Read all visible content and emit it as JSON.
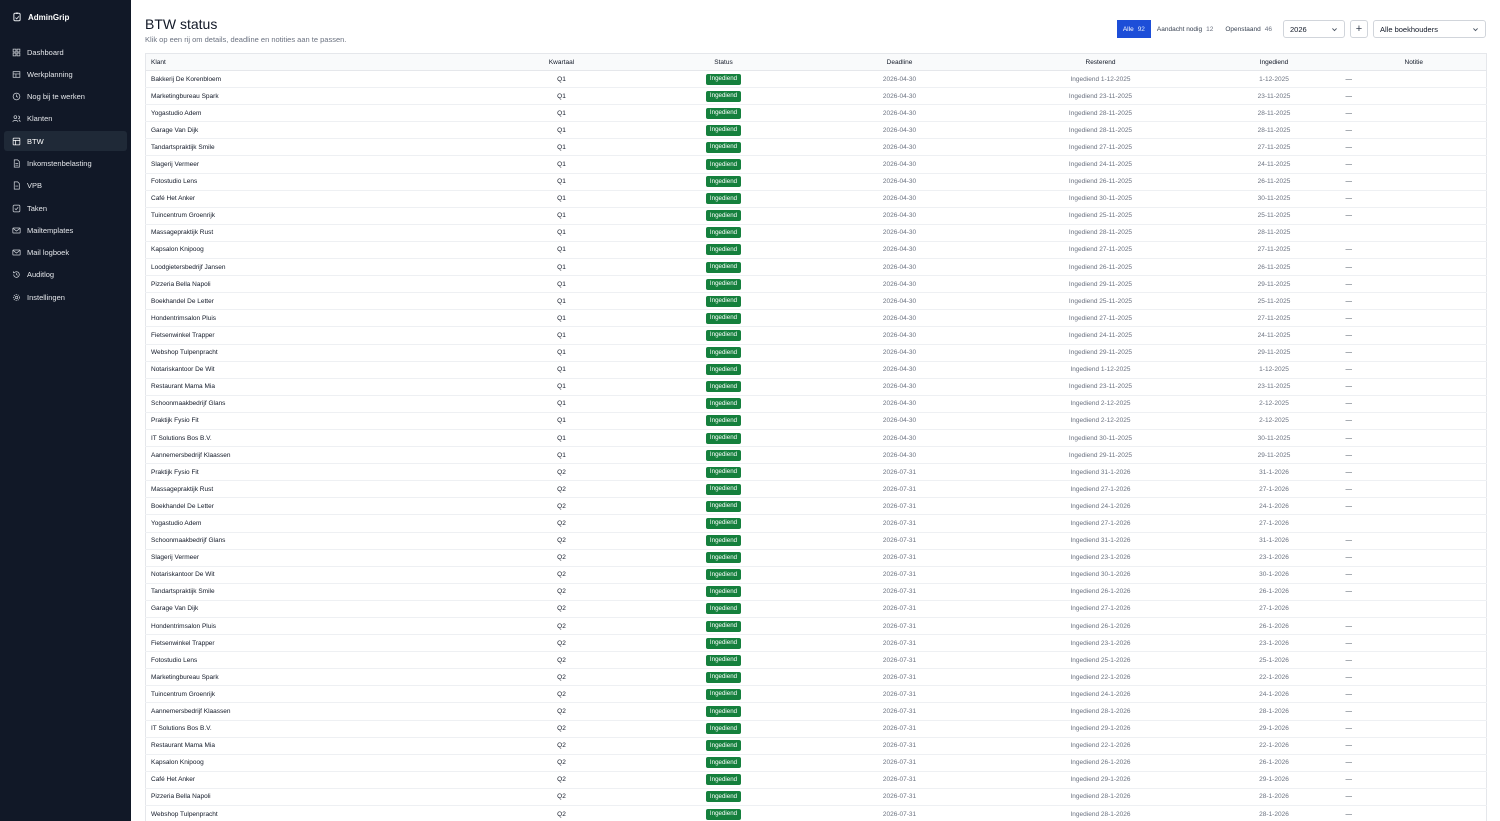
{
  "app": {
    "name": "AdminGrip"
  },
  "sidebar": {
    "items": [
      {
        "label": "Dashboard",
        "icon": "grid-icon",
        "key": "dashboard"
      },
      {
        "label": "Werkplanning",
        "icon": "table-icon",
        "key": "werkplanning"
      },
      {
        "label": "Nog bij te werken",
        "icon": "clock-icon",
        "key": "nog-bij-te-werken"
      },
      {
        "label": "Klanten",
        "icon": "users-icon",
        "key": "klanten"
      },
      {
        "label": "BTW",
        "icon": "receipt-icon",
        "key": "btw",
        "active": true
      },
      {
        "label": "Inkomstenbelasting",
        "icon": "document-icon",
        "key": "inkomstenbelasting"
      },
      {
        "label": "VPB",
        "icon": "file-icon",
        "key": "vpb"
      },
      {
        "label": "Taken",
        "icon": "checkbox-icon",
        "key": "taken"
      },
      {
        "label": "Mailtemplates",
        "icon": "mail-icon",
        "key": "mailtemplates"
      },
      {
        "label": "Mail logboek",
        "icon": "mail-log-icon",
        "key": "mail-logboek"
      },
      {
        "label": "Auditlog",
        "icon": "history-icon",
        "key": "auditlog"
      },
      {
        "label": "Instellingen",
        "icon": "gear-icon",
        "key": "instellingen"
      }
    ]
  },
  "page": {
    "title": "BTW status",
    "subtitle": "Klik op een rij om details, deadline en notities aan te passen."
  },
  "filters": {
    "segments": [
      {
        "label": "Alle",
        "count": "92",
        "active": true
      },
      {
        "label": "Aandacht nodig",
        "count": "12"
      },
      {
        "label": "Openstaand",
        "count": "46"
      }
    ],
    "year": "2026",
    "add_label": "+",
    "bookkeeper": "Alle boekhouders"
  },
  "table": {
    "columns": [
      "Klant",
      "Kwartaal",
      "Status",
      "Deadline",
      "Resterend",
      "Ingediend",
      "Notitie"
    ],
    "rows": [
      [
        "Bakkerij De Korenbloem",
        "Q1",
        "Ingediend",
        "2026-04-30",
        "Ingediend 1-12-2025",
        "1-12-2025",
        "—"
      ],
      [
        "Marketingbureau Spark",
        "Q1",
        "Ingediend",
        "2026-04-30",
        "Ingediend 23-11-2025",
        "23-11-2025",
        "—"
      ],
      [
        "Yogastudio Adem",
        "Q1",
        "Ingediend",
        "2026-04-30",
        "Ingediend 28-11-2025",
        "28-11-2025",
        "—"
      ],
      [
        "Garage Van Dijk",
        "Q1",
        "Ingediend",
        "2026-04-30",
        "Ingediend 28-11-2025",
        "28-11-2025",
        "—"
      ],
      [
        "Tandartspraktijk Smile",
        "Q1",
        "Ingediend",
        "2026-04-30",
        "Ingediend 27-11-2025",
        "27-11-2025",
        "—"
      ],
      [
        "Slagerij Vermeer",
        "Q1",
        "Ingediend",
        "2026-04-30",
        "Ingediend 24-11-2025",
        "24-11-2025",
        "—"
      ],
      [
        "Fotostudio Lens",
        "Q1",
        "Ingediend",
        "2026-04-30",
        "Ingediend 26-11-2025",
        "26-11-2025",
        "—"
      ],
      [
        "Café Het Anker",
        "Q1",
        "Ingediend",
        "2026-04-30",
        "Ingediend 30-11-2025",
        "30-11-2025",
        "—"
      ],
      [
        "Tuincentrum Groenrijk",
        "Q1",
        "Ingediend",
        "2026-04-30",
        "Ingediend 25-11-2025",
        "25-11-2025",
        "—"
      ],
      [
        "Massagepraktijk Rust",
        "Q1",
        "Ingediend",
        "2026-04-30",
        "Ingediend 28-11-2025",
        "28-11-2025",
        ""
      ],
      [
        "Kapsalon Knipoog",
        "Q1",
        "Ingediend",
        "2026-04-30",
        "Ingediend 27-11-2025",
        "27-11-2025",
        "—"
      ],
      [
        "Loodgietersbedrijf Jansen",
        "Q1",
        "Ingediend",
        "2026-04-30",
        "Ingediend 26-11-2025",
        "26-11-2025",
        "—"
      ],
      [
        "Pizzeria Bella Napoli",
        "Q1",
        "Ingediend",
        "2026-04-30",
        "Ingediend 29-11-2025",
        "29-11-2025",
        "—"
      ],
      [
        "Boekhandel De Letter",
        "Q1",
        "Ingediend",
        "2026-04-30",
        "Ingediend 25-11-2025",
        "25-11-2025",
        "—"
      ],
      [
        "Hondentrimsalon Pluis",
        "Q1",
        "Ingediend",
        "2026-04-30",
        "Ingediend 27-11-2025",
        "27-11-2025",
        "—"
      ],
      [
        "Fietsenwinkel Trapper",
        "Q1",
        "Ingediend",
        "2026-04-30",
        "Ingediend 24-11-2025",
        "24-11-2025",
        "—"
      ],
      [
        "Webshop Tulpenpracht",
        "Q1",
        "Ingediend",
        "2026-04-30",
        "Ingediend 29-11-2025",
        "29-11-2025",
        "—"
      ],
      [
        "Notariskantoor De Wit",
        "Q1",
        "Ingediend",
        "2026-04-30",
        "Ingediend 1-12-2025",
        "1-12-2025",
        "—"
      ],
      [
        "Restaurant Mama Mia",
        "Q1",
        "Ingediend",
        "2026-04-30",
        "Ingediend 23-11-2025",
        "23-11-2025",
        "—"
      ],
      [
        "Schoonmaakbedrijf Glans",
        "Q1",
        "Ingediend",
        "2026-04-30",
        "Ingediend 2-12-2025",
        "2-12-2025",
        "—"
      ],
      [
        "Praktijk Fysio Fit",
        "Q1",
        "Ingediend",
        "2026-04-30",
        "Ingediend 2-12-2025",
        "2-12-2025",
        "—"
      ],
      [
        "IT Solutions Bos B.V.",
        "Q1",
        "Ingediend",
        "2026-04-30",
        "Ingediend 30-11-2025",
        "30-11-2025",
        "—"
      ],
      [
        "Aannemersbedrijf Klaassen",
        "Q1",
        "Ingediend",
        "2026-04-30",
        "Ingediend 29-11-2025",
        "29-11-2025",
        "—"
      ],
      [
        "Praktijk Fysio Fit",
        "Q2",
        "Ingediend",
        "2026-07-31",
        "Ingediend 31-1-2026",
        "31-1-2026",
        "—"
      ],
      [
        "Massagepraktijk Rust",
        "Q2",
        "Ingediend",
        "2026-07-31",
        "Ingediend 27-1-2026",
        "27-1-2026",
        "—"
      ],
      [
        "Boekhandel De Letter",
        "Q2",
        "Ingediend",
        "2026-07-31",
        "Ingediend 24-1-2026",
        "24-1-2026",
        "—"
      ],
      [
        "Yogastudio Adem",
        "Q2",
        "Ingediend",
        "2026-07-31",
        "Ingediend 27-1-2026",
        "27-1-2026",
        ""
      ],
      [
        "Schoonmaakbedrijf Glans",
        "Q2",
        "Ingediend",
        "2026-07-31",
        "Ingediend 31-1-2026",
        "31-1-2026",
        "—"
      ],
      [
        "Slagerij Vermeer",
        "Q2",
        "Ingediend",
        "2026-07-31",
        "Ingediend 23-1-2026",
        "23-1-2026",
        "—"
      ],
      [
        "Notariskantoor De Wit",
        "Q2",
        "Ingediend",
        "2026-07-31",
        "Ingediend 30-1-2026",
        "30-1-2026",
        "—"
      ],
      [
        "Tandartspraktijk Smile",
        "Q2",
        "Ingediend",
        "2026-07-31",
        "Ingediend 26-1-2026",
        "26-1-2026",
        "—"
      ],
      [
        "Garage Van Dijk",
        "Q2",
        "Ingediend",
        "2026-07-31",
        "Ingediend 27-1-2026",
        "27-1-2026",
        ""
      ],
      [
        "Hondentrimsalon Pluis",
        "Q2",
        "Ingediend",
        "2026-07-31",
        "Ingediend 26-1-2026",
        "26-1-2026",
        "—"
      ],
      [
        "Fietsenwinkel Trapper",
        "Q2",
        "Ingediend",
        "2026-07-31",
        "Ingediend 23-1-2026",
        "23-1-2026",
        "—"
      ],
      [
        "Fotostudio Lens",
        "Q2",
        "Ingediend",
        "2026-07-31",
        "Ingediend 25-1-2026",
        "25-1-2026",
        "—"
      ],
      [
        "Marketingbureau Spark",
        "Q2",
        "Ingediend",
        "2026-07-31",
        "Ingediend 22-1-2026",
        "22-1-2026",
        "—"
      ],
      [
        "Tuincentrum Groenrijk",
        "Q2",
        "Ingediend",
        "2026-07-31",
        "Ingediend 24-1-2026",
        "24-1-2026",
        "—"
      ],
      [
        "Aannemersbedrijf Klaassen",
        "Q2",
        "Ingediend",
        "2026-07-31",
        "Ingediend 28-1-2026",
        "28-1-2026",
        "—"
      ],
      [
        "IT Solutions Bos B.V.",
        "Q2",
        "Ingediend",
        "2026-07-31",
        "Ingediend 29-1-2026",
        "29-1-2026",
        "—"
      ],
      [
        "Restaurant Mama Mia",
        "Q2",
        "Ingediend",
        "2026-07-31",
        "Ingediend 22-1-2026",
        "22-1-2026",
        "—"
      ],
      [
        "Kapsalon Knipoog",
        "Q2",
        "Ingediend",
        "2026-07-31",
        "Ingediend 26-1-2026",
        "26-1-2026",
        "—"
      ],
      [
        "Café Het Anker",
        "Q2",
        "Ingediend",
        "2026-07-31",
        "Ingediend 29-1-2026",
        "29-1-2026",
        "—"
      ],
      [
        "Pizzeria Bella Napoli",
        "Q2",
        "Ingediend",
        "2026-07-31",
        "Ingediend 28-1-2026",
        "28-1-2026",
        "—"
      ],
      [
        "Webshop Tulpenpracht",
        "Q2",
        "Ingediend",
        "2026-07-31",
        "Ingediend 28-1-2026",
        "28-1-2026",
        "—"
      ]
    ]
  },
  "colors": {
    "sidebar_bg": "#111827",
    "accent": "#1d4ed8",
    "status_ingediend": "#15803d"
  }
}
